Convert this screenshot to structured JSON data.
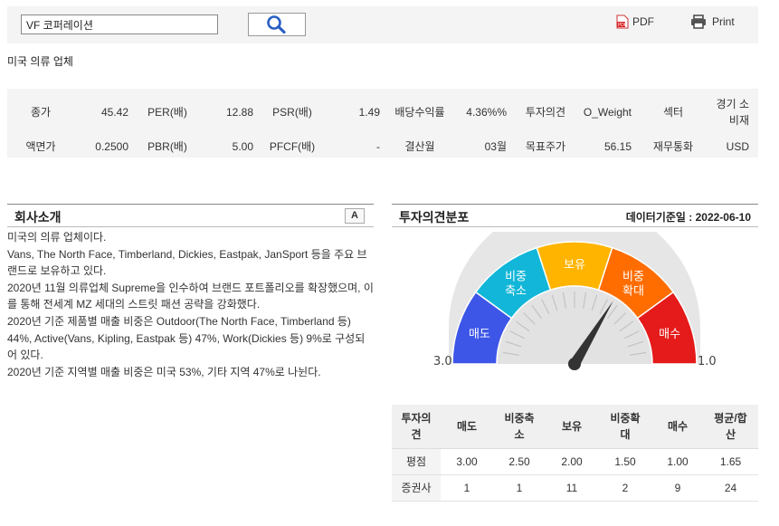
{
  "search": {
    "value": "VF 코퍼레이션"
  },
  "toolbar": {
    "pdf_label": "PDF",
    "print_label": "Print"
  },
  "industry": "미국 의류 업체",
  "metrics": {
    "row1": [
      {
        "label": "종가",
        "value": "45.42"
      },
      {
        "label": "PER(배)",
        "value": "12.88"
      },
      {
        "label": "PSR(배)",
        "value": "1.49"
      },
      {
        "label": "배당수익률",
        "value": "4.36%%"
      },
      {
        "label": "투자의견",
        "value": "O_Weight"
      },
      {
        "label": "섹터",
        "value": "경기 소비재"
      }
    ],
    "row2": [
      {
        "label": "액면가",
        "value": "0.2500"
      },
      {
        "label": "PBR(배)",
        "value": "5.00"
      },
      {
        "label": "PFCF(배)",
        "value": "-"
      },
      {
        "label": "결산월",
        "value": "03월"
      },
      {
        "label": "목표주가",
        "value": "56.15"
      },
      {
        "label": "재무통화",
        "value": "USD"
      }
    ]
  },
  "intro": {
    "title": "회사소개",
    "font_btn": "A",
    "lines": [
      "미국의 의류 업체이다.",
      "Vans, The North Face, Timberland, Dickies, Eastpak, JanSport 등을 주요 브랜드로 보유하고 있다.",
      "2020년 11월 의류업체 Supreme을 인수하여 브랜드 포트폴리오를 확장했으며, 이를 통해 전세계 MZ 세대의 스트릿 패션 공략을 강화했다.",
      "2020년 기준 제품별 매출 비중은 Outdoor(The North Face, Timberland 등) 44%, Active(Vans, Kipling, Eastpak 등) 47%, Work(Dickies 등) 9%로 구성되어 있다.",
      "2020년 기준 지역별 매출 비중은 미국 53%, 기타 지역 47%로 나뉜다."
    ]
  },
  "opinion": {
    "title": "투자의견분포",
    "ref_date": "데이터기준일 : 2022-06-10",
    "gauge": {
      "score": 1.65,
      "min_label": "3.0",
      "max_label": "1.0",
      "segments": [
        {
          "label": "매도",
          "color": "#3d56e8"
        },
        {
          "label": "비중\n축소",
          "color": "#12b6d8"
        },
        {
          "label": "보유",
          "color": "#ffb400"
        },
        {
          "label": "비중\n확대",
          "color": "#ff6d00"
        },
        {
          "label": "매수",
          "color": "#e51a1a"
        }
      ]
    },
    "table": {
      "headers": [
        "투자의견",
        "매도",
        "비중축소",
        "보유",
        "비중확대",
        "매수",
        "평균/합산"
      ],
      "rows": [
        {
          "label": "평점",
          "values": [
            "3.00",
            "2.50",
            "2.00",
            "1.50",
            "1.00",
            "1.65"
          ]
        },
        {
          "label": "증권사",
          "values": [
            "1",
            "1",
            "11",
            "2",
            "9",
            "24"
          ]
        }
      ]
    }
  }
}
